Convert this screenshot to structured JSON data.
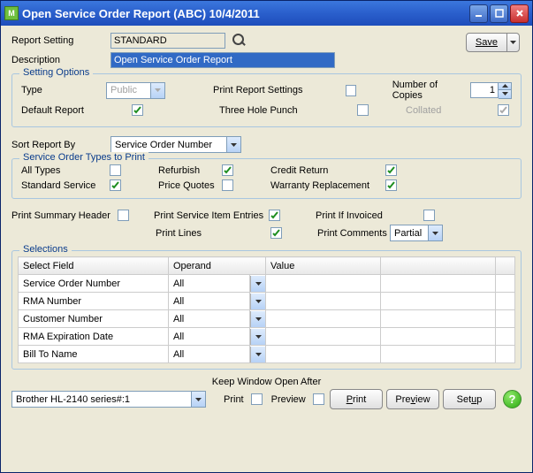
{
  "window": {
    "title": "Open Service Order Report (ABC) 10/4/2011"
  },
  "buttons": {
    "save": "Save",
    "print": "Print",
    "preview": "Preview",
    "setup": "Setup"
  },
  "fields": {
    "reportSettingLabel": "Report Setting",
    "reportSettingValue": "STANDARD",
    "descriptionLabel": "Description",
    "descriptionValue": "Open Service Order Report"
  },
  "settingOptions": {
    "legend": "Setting Options",
    "typeLabel": "Type",
    "typeValue": "Public",
    "defaultReportLabel": "Default Report",
    "printReportSettingsLabel": "Print Report Settings",
    "threeHolePunchLabel": "Three Hole Punch",
    "numCopiesLabel": "Number of Copies",
    "numCopiesValue": "1",
    "collatedLabel": "Collated"
  },
  "sort": {
    "label": "Sort Report By",
    "value": "Service Order Number"
  },
  "orderTypes": {
    "legend": "Service Order Types to Print",
    "allTypes": "All Types",
    "standardService": "Standard Service",
    "refurbish": "Refurbish",
    "priceQuotes": "Price Quotes",
    "creditReturn": "Credit Return",
    "warrantyReplacement": "Warranty Replacement"
  },
  "printOptions": {
    "printSummaryHeader": "Print Summary Header",
    "printServiceItemEntries": "Print Service Item Entries",
    "printLines": "Print Lines",
    "printIfInvoiced": "Print If Invoiced",
    "printCommentsLabel": "Print Comments",
    "printCommentsValue": "Partial"
  },
  "selections": {
    "legend": "Selections",
    "headers": {
      "selectField": "Select Field",
      "operand": "Operand",
      "value": "Value"
    },
    "rows": [
      {
        "field": "Service Order Number",
        "operand": "All"
      },
      {
        "field": "RMA Number",
        "operand": "All"
      },
      {
        "field": "Customer Number",
        "operand": "All"
      },
      {
        "field": "RMA Expiration Date",
        "operand": "All"
      },
      {
        "field": "Bill To Name",
        "operand": "All"
      }
    ]
  },
  "footer": {
    "printerValue": "Brother HL-2140 series#:1",
    "keepWindowLabel": "Keep Window Open After",
    "printLabel": "Print",
    "previewLabel": "Preview"
  }
}
